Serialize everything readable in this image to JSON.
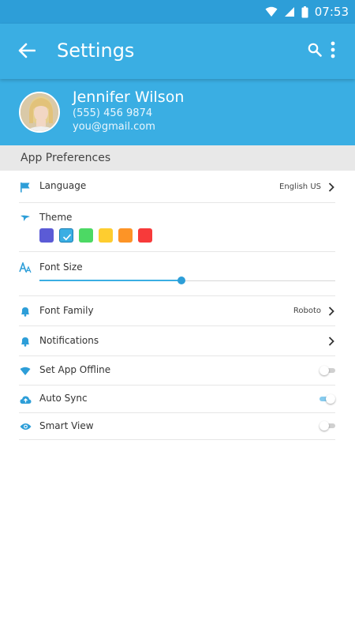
{
  "status_bar": {
    "time": "07:53",
    "icons": [
      "wifi-icon",
      "signal-icon",
      "battery-icon"
    ]
  },
  "app_bar": {
    "title": "Settings",
    "back_icon": "arrow-left-icon",
    "search_icon": "search-icon",
    "more_icon": "more-vertical-icon"
  },
  "profile": {
    "name": "Jennifer Wilson",
    "phone": "(555) 456 9874",
    "email": "you@gmail.com"
  },
  "section": {
    "title": "App Preferences"
  },
  "preferences": {
    "language": {
      "label": "Language",
      "value": "English US",
      "icon": "flag-icon"
    },
    "theme": {
      "label": "Theme",
      "icon": "theme-icon",
      "colors": [
        "#5b5bd6",
        "#3aaee3",
        "#4cd964",
        "#fecd2f",
        "#fd9426",
        "#f73a3a"
      ],
      "selected_index": 1
    },
    "font_size": {
      "label": "Font Size",
      "icon": "font-size-icon",
      "level": 0.48
    },
    "font_family": {
      "label": "Font Family",
      "value": "Roboto",
      "icon": "bell-icon"
    },
    "notifications": {
      "label": "Notifications",
      "icon": "bell-icon"
    },
    "offline": {
      "label": "Set App Offline",
      "icon": "wifi-icon",
      "enabled": false
    },
    "auto_sync": {
      "label": "Auto Sync",
      "icon": "cloud-upload-icon",
      "enabled": true
    },
    "smart_view": {
      "label": "Smart View",
      "icon": "eye-icon",
      "enabled": false
    }
  },
  "colors": {
    "primary": "#3aaee3",
    "primary_dark": "#2d9ed8",
    "section_bg": "#e8e8e8"
  }
}
